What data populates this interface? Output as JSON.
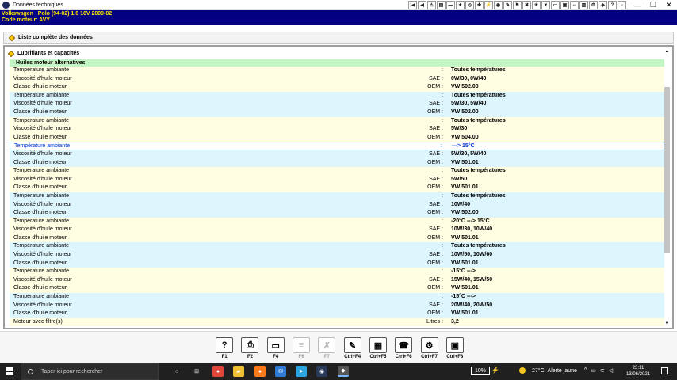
{
  "window": {
    "title": "Données techniques",
    "controls": [
      "minimize-icon",
      "maximize-icon",
      "close-icon"
    ],
    "control_glyphs": [
      "—",
      "❐",
      "✕"
    ]
  },
  "toolbar_icons": [
    {
      "name": "first-page-icon",
      "glyph": "|◀"
    },
    {
      "name": "previous-icon",
      "glyph": "◀"
    },
    {
      "name": "warning-icon",
      "glyph": "⚠"
    },
    {
      "name": "document-icon",
      "glyph": "▤"
    },
    {
      "name": "car-icon",
      "glyph": "▬"
    },
    {
      "name": "engine-icon",
      "glyph": "✦"
    },
    {
      "name": "wheel-icon",
      "glyph": "◎"
    },
    {
      "name": "diagnostic-icon",
      "glyph": "✚"
    },
    {
      "name": "electrical-icon",
      "glyph": "⚡"
    },
    {
      "name": "brake-icon",
      "glyph": "◉"
    },
    {
      "name": "tools-icon",
      "glyph": "✎"
    },
    {
      "name": "flag-icon",
      "glyph": "⚑"
    },
    {
      "name": "wrench-icon",
      "glyph": "✖"
    },
    {
      "name": "lightbulb-icon",
      "glyph": "☀"
    },
    {
      "name": "bookmark-icon",
      "glyph": "▼"
    },
    {
      "name": "comment-icon",
      "glyph": "▭"
    },
    {
      "name": "lock-icon",
      "glyph": "▣"
    },
    {
      "name": "key-icon",
      "glyph": "⌐"
    },
    {
      "name": "chart-icon",
      "glyph": "▥"
    },
    {
      "name": "settings-icon",
      "glyph": "⚙"
    },
    {
      "name": "network-icon",
      "glyph": "◈"
    },
    {
      "name": "help-icon",
      "glyph": "?"
    },
    {
      "name": "exit-icon",
      "glyph": "⌂"
    }
  ],
  "vehicle": {
    "line1": "Volkswagen   Polo (94-02) 1,6 16V 2000-02",
    "line2": "Code moteur: AVY"
  },
  "panel_full": {
    "label": "Liste complète des données"
  },
  "panel_lub": {
    "label": "Lubrifiants et capacités"
  },
  "table": {
    "section_title": "Huiles moteur alternatives",
    "rows": [
      {
        "label": "Température ambiante",
        "prefix": ":",
        "value": "Toutes températures",
        "style": "y"
      },
      {
        "label": "Viscosité d'huile moteur",
        "prefix": "SAE :",
        "value": "0W/30, 0W/40",
        "style": "y"
      },
      {
        "label": "Classe d'huile moteur",
        "prefix": "OEM :",
        "value": "VW 502.00",
        "style": "y"
      },
      {
        "label": "Température ambiante",
        "prefix": ":",
        "value": "Toutes températures",
        "style": "b"
      },
      {
        "label": "Viscosité d'huile moteur",
        "prefix": "SAE :",
        "value": "5W/30, 5W/40",
        "style": "b"
      },
      {
        "label": "Classe d'huile moteur",
        "prefix": "OEM :",
        "value": "VW 502.00",
        "style": "b"
      },
      {
        "label": "Température ambiante",
        "prefix": ":",
        "value": "Toutes températures",
        "style": "y"
      },
      {
        "label": "Viscosité d'huile moteur",
        "prefix": "SAE :",
        "value": "5W/30",
        "style": "y"
      },
      {
        "label": "Classe d'huile moteur",
        "prefix": "OEM :",
        "value": "VW 504.00",
        "style": "y"
      },
      {
        "label": "Température ambiante",
        "prefix": ":",
        "value": "---> 15°C",
        "style": "sel"
      },
      {
        "label": "Viscosité d'huile moteur",
        "prefix": "SAE :",
        "value": "5W/30, 5W/40",
        "style": "b"
      },
      {
        "label": "Classe d'huile moteur",
        "prefix": "OEM :",
        "value": "VW 501.01",
        "style": "b"
      },
      {
        "label": "Température ambiante",
        "prefix": ":",
        "value": "Toutes températures",
        "style": "y"
      },
      {
        "label": "Viscosité d'huile moteur",
        "prefix": "SAE :",
        "value": "5W/50",
        "style": "y"
      },
      {
        "label": "Classe d'huile moteur",
        "prefix": "OEM :",
        "value": "VW 501.01",
        "style": "y"
      },
      {
        "label": "Température ambiante",
        "prefix": ":",
        "value": "Toutes températures",
        "style": "b"
      },
      {
        "label": "Viscosité d'huile moteur",
        "prefix": "SAE :",
        "value": "10W/40",
        "style": "b"
      },
      {
        "label": "Classe d'huile moteur",
        "prefix": "OEM :",
        "value": "VW 502.00",
        "style": "b"
      },
      {
        "label": "Température ambiante",
        "prefix": ":",
        "value": "-20°C ---> 15°C",
        "style": "y"
      },
      {
        "label": "Viscosité d'huile moteur",
        "prefix": "SAE :",
        "value": "10W/30, 10W/40",
        "style": "y"
      },
      {
        "label": "Classe d'huile moteur",
        "prefix": "OEM :",
        "value": "VW 501.01",
        "style": "y"
      },
      {
        "label": "Température ambiante",
        "prefix": ":",
        "value": "Toutes températures",
        "style": "b"
      },
      {
        "label": "Viscosité d'huile moteur",
        "prefix": "SAE :",
        "value": "10W/50, 10W/60",
        "style": "b"
      },
      {
        "label": "Classe d'huile moteur",
        "prefix": "OEM :",
        "value": "VW 501.01",
        "style": "b"
      },
      {
        "label": "Température ambiante",
        "prefix": ":",
        "value": "-15°C --->",
        "style": "y"
      },
      {
        "label": "Viscosité d'huile moteur",
        "prefix": "SAE :",
        "value": "15W/40, 15W/50",
        "style": "y"
      },
      {
        "label": "Classe d'huile moteur",
        "prefix": "OEM :",
        "value": "VW 501.01",
        "style": "y"
      },
      {
        "label": "Température ambiante",
        "prefix": ":",
        "value": "-15°C --->",
        "style": "b"
      },
      {
        "label": "Viscosité d'huile moteur",
        "prefix": "SAE :",
        "value": "20W/40, 20W/50",
        "style": "b"
      },
      {
        "label": "Classe d'huile moteur",
        "prefix": "OEM :",
        "value": "VW 501.01",
        "style": "b"
      },
      {
        "label": "Moteur avec filtre(s)",
        "prefix": "Litres :",
        "value": "3,2",
        "style": "y"
      }
    ]
  },
  "scrollbar": {
    "up_glyph": "▲",
    "down_glyph": "▼"
  },
  "fkeys": [
    {
      "name": "help-icon",
      "glyph": "?",
      "label": "F1",
      "disabled": false
    },
    {
      "name": "print-icon",
      "glyph": "⎙",
      "label": "F2",
      "disabled": false
    },
    {
      "name": "screen-icon",
      "glyph": "▭",
      "label": "F4",
      "disabled": false
    },
    {
      "name": "options-icon",
      "glyph": "≡",
      "label": "F6",
      "disabled": true
    },
    {
      "name": "tools-icon",
      "glyph": "✗",
      "label": "F7",
      "disabled": true
    },
    {
      "name": "notes-icon",
      "glyph": "✎",
      "label": "Ctrl+F4",
      "disabled": false
    },
    {
      "name": "report-icon",
      "glyph": "▦",
      "label": "Ctrl+F5",
      "disabled": false
    },
    {
      "name": "alert-icon",
      "glyph": "☎",
      "label": "Ctrl+F6",
      "disabled": false
    },
    {
      "name": "settings-icon",
      "glyph": "⚙",
      "label": "Ctrl+F7",
      "disabled": false
    },
    {
      "name": "save-icon",
      "glyph": "▣",
      "label": "Ctrl+F8",
      "disabled": false
    }
  ],
  "taskbar": {
    "search_placeholder": "Taper ici pour rechercher",
    "apps": [
      {
        "name": "task-view-icon",
        "glyph": "○",
        "color": "#202020"
      },
      {
        "name": "widgets-icon",
        "glyph": "⊞",
        "color": "#202020"
      },
      {
        "name": "chrome-icon",
        "glyph": "●",
        "color": "#e0463a"
      },
      {
        "name": "file-explorer-icon",
        "glyph": "▰",
        "color": "#f0c030"
      },
      {
        "name": "firefox-icon",
        "glyph": "●",
        "color": "#ff7a1a"
      },
      {
        "name": "mail-icon",
        "glyph": "✉",
        "color": "#2f7bd6"
      },
      {
        "name": "telegram-icon",
        "glyph": "➤",
        "color": "#2ca4df"
      },
      {
        "name": "steam-icon",
        "glyph": "◉",
        "color": "#2a3b5a"
      },
      {
        "name": "autodata-icon",
        "glyph": "◆",
        "color": "#555555"
      }
    ],
    "battery": "10%",
    "weather_temp": "27°C",
    "weather_text": "Alerte jaune",
    "tray_glyphs": [
      "^",
      "▭",
      "⊂",
      "◁"
    ],
    "time": "23:11",
    "date": "13/06/2021"
  }
}
